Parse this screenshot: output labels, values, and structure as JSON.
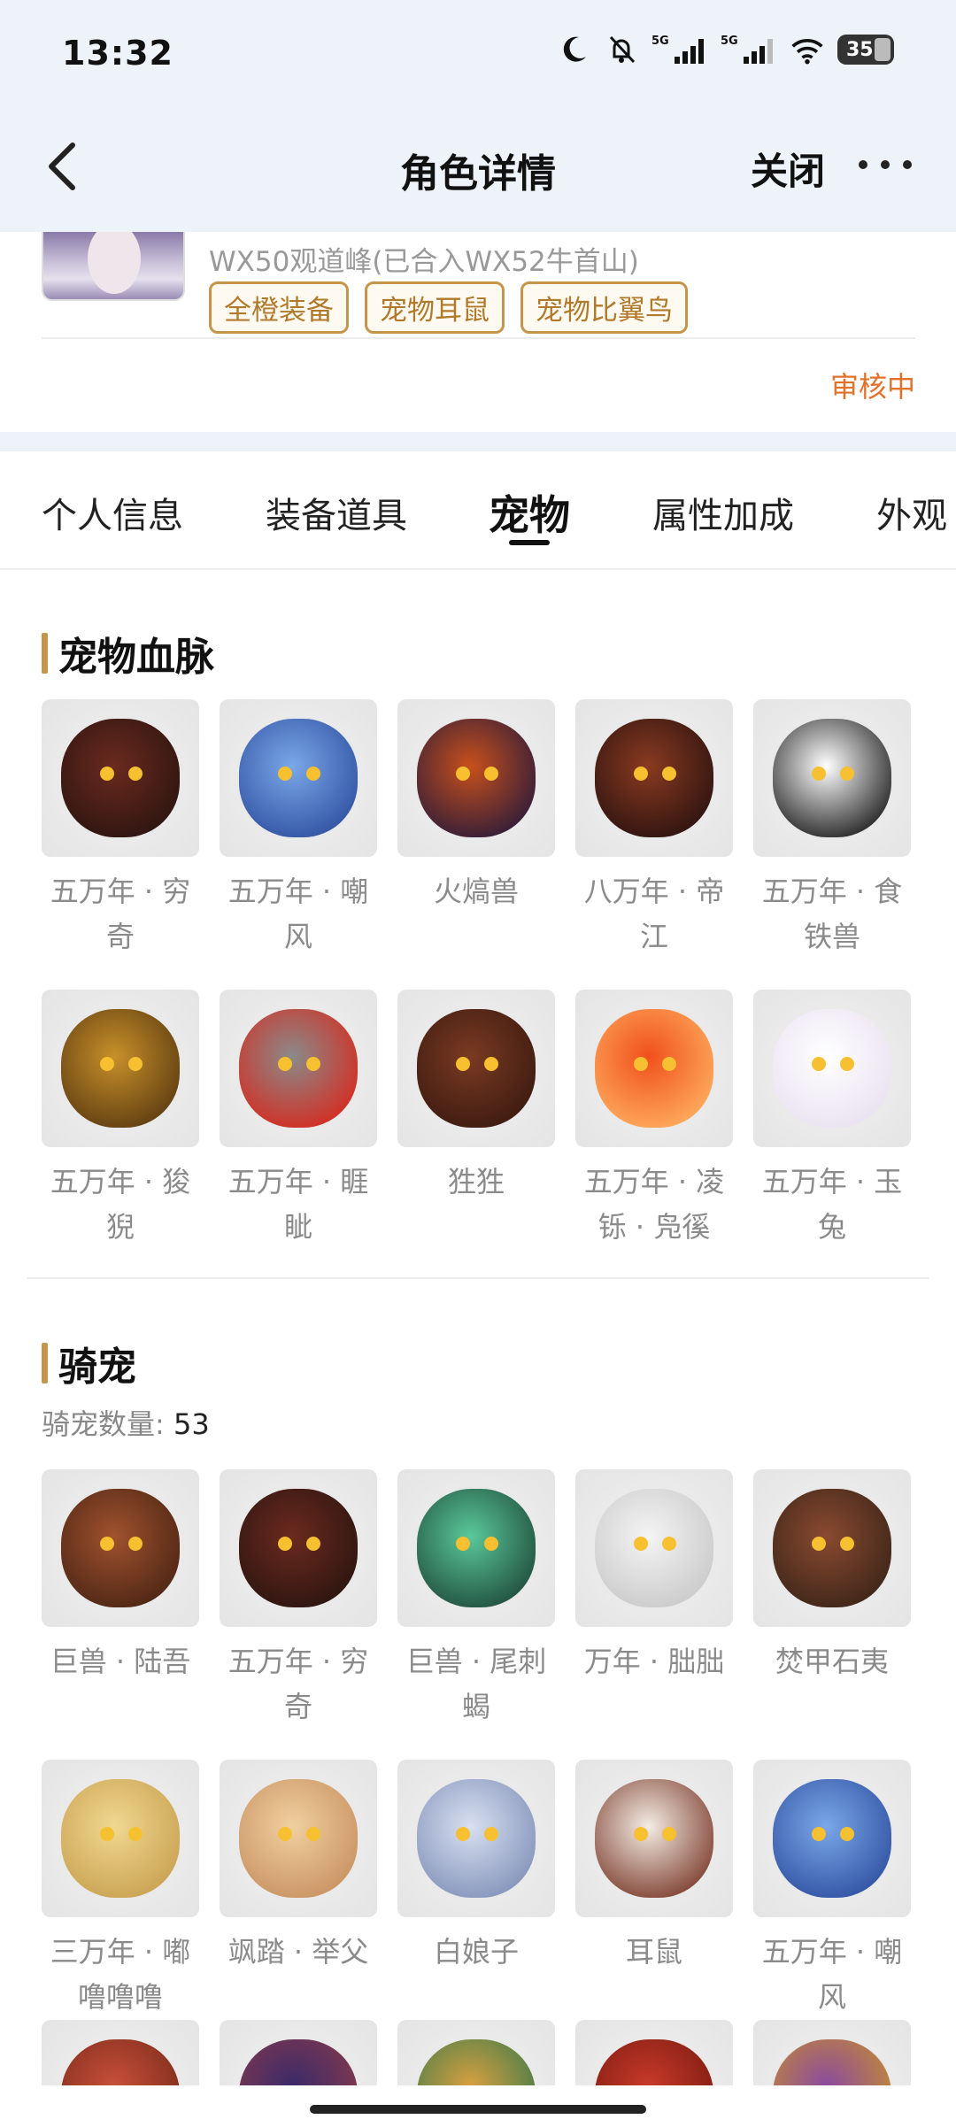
{
  "status_bar": {
    "time": "13:32",
    "network_1": "5G",
    "network_2": "5G",
    "battery": "35"
  },
  "nav": {
    "title": "角色详情",
    "close_label": "关闭"
  },
  "role": {
    "server": "WX50观道峰(已合入WX52牛首山)",
    "tags": [
      "全橙装备",
      "宠物耳鼠",
      "宠物比翼鸟"
    ],
    "status": "审核中"
  },
  "tabs": [
    "个人信息",
    "装备道具",
    "宠物",
    "属性加成",
    "外观"
  ],
  "active_tab": "宠物",
  "pet_bloodline": {
    "title": "宠物血脉",
    "items": [
      {
        "name": "五万年 · 穷奇",
        "colors": [
          "#6b2a1e",
          "#2a1410"
        ]
      },
      {
        "name": "五万年 · 嘲风",
        "colors": [
          "#7aa8e8",
          "#2e4fa0"
        ]
      },
      {
        "name": "火熇兽",
        "colors": [
          "#c8501c",
          "#2a1a3a"
        ]
      },
      {
        "name": "八万年 · 帝江",
        "colors": [
          "#8a3a20",
          "#2a1210"
        ]
      },
      {
        "name": "五万年 · 食铁兽",
        "colors": [
          "#ffffff",
          "#1a1a1a"
        ]
      },
      {
        "name": "五万年 · 狻猊",
        "colors": [
          "#c8902a",
          "#5a3a10"
        ]
      },
      {
        "name": "五万年 · 睚眦",
        "colors": [
          "#8a8a8a",
          "#d8281c"
        ]
      },
      {
        "name": "狌狌",
        "colors": [
          "#7a3a22",
          "#3a1a10"
        ]
      },
      {
        "name": "五万年 · 凌铄 · 凫徯",
        "colors": [
          "#f0501c",
          "#ffb060"
        ]
      },
      {
        "name": "五万年 · 玉兔",
        "colors": [
          "#ffffff",
          "#e8e0f0"
        ]
      }
    ]
  },
  "mounts": {
    "title": "骑宠",
    "count_label": "骑宠数量:",
    "count": "53",
    "items": [
      {
        "name": "巨兽 · 陆吾",
        "colors": [
          "#a0522d",
          "#4a2414"
        ]
      },
      {
        "name": "五万年 · 穷奇",
        "colors": [
          "#6b2a1e",
          "#2a1410"
        ]
      },
      {
        "name": "巨兽 · 尾刺蝎",
        "colors": [
          "#5ac89a",
          "#1e4a3a"
        ]
      },
      {
        "name": "万年 · 朏朏",
        "colors": [
          "#f4f4f4",
          "#c8c8c8"
        ]
      },
      {
        "name": "焚甲石夷",
        "colors": [
          "#8a4a30",
          "#3a2418"
        ]
      },
      {
        "name": "三万年 · 嘟噜噜噜",
        "colors": [
          "#f0d890",
          "#c8a050"
        ]
      },
      {
        "name": "飒踏 · 举父",
        "colors": [
          "#f0d0a0",
          "#c89060"
        ]
      },
      {
        "name": "白娘子",
        "colors": [
          "#d8e0f0",
          "#8090b8"
        ]
      },
      {
        "name": "耳鼠",
        "colors": [
          "#f4ece4",
          "#7a3a2a"
        ]
      },
      {
        "name": "五万年 · 嘲风",
        "colors": [
          "#7aa8e8",
          "#2e4fa0"
        ]
      }
    ],
    "partial_colors": [
      [
        "#c8503a",
        "#7a2a1a"
      ],
      [
        "#3a2a6a",
        "#8a3a4a"
      ],
      [
        "#d8a040",
        "#3a7a4a"
      ],
      [
        "#c83a2a",
        "#7a1a10"
      ],
      [
        "#8a4aa0",
        "#c8902a"
      ]
    ]
  }
}
